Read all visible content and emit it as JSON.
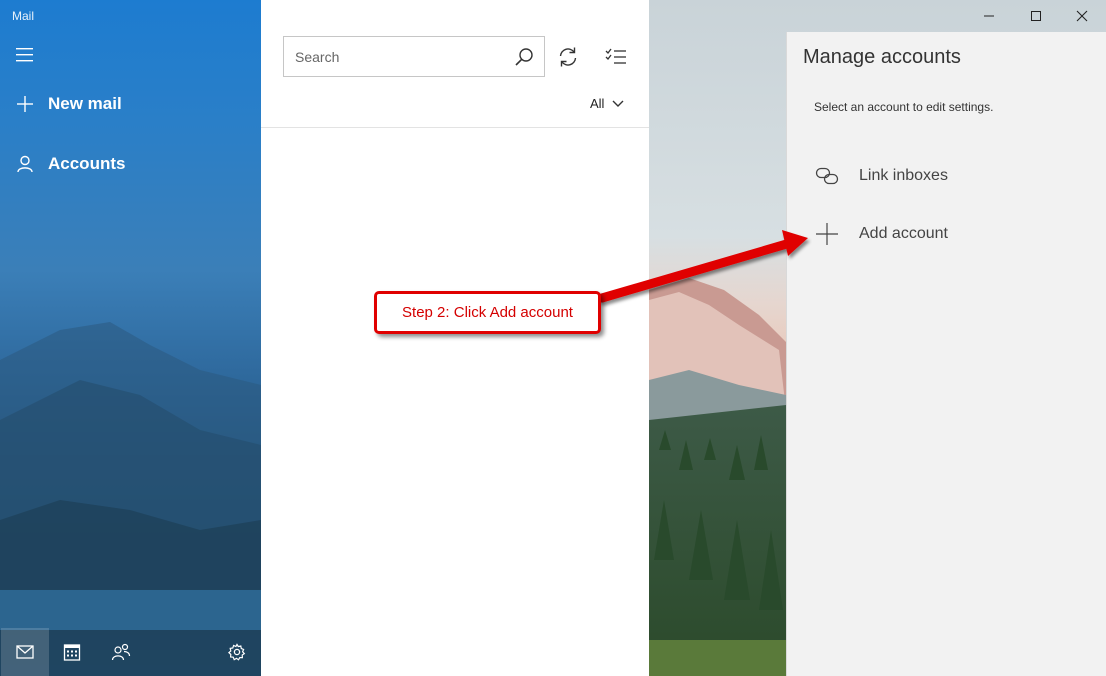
{
  "app": {
    "title": "Mail"
  },
  "nav": {
    "new_mail": "New mail",
    "accounts": "Accounts",
    "bottom": [
      {
        "icon": "mail-icon"
      },
      {
        "icon": "calendar-icon"
      },
      {
        "icon": "people-icon"
      },
      {
        "icon": "gear-icon"
      }
    ]
  },
  "list": {
    "search_placeholder": "Search",
    "filter_label": "All"
  },
  "manage": {
    "title": "Manage accounts",
    "subtitle": "Select an account to edit settings.",
    "items": [
      {
        "label": "Link inboxes",
        "icon": "link-icon"
      },
      {
        "label": "Add account",
        "icon": "plus-icon"
      }
    ]
  },
  "annotation": {
    "text": "Step 2: Click Add account",
    "color": "#e00000"
  },
  "colors": {
    "nav_blue": "#1d7cd0",
    "panel_bg": "#f2f2f2"
  }
}
